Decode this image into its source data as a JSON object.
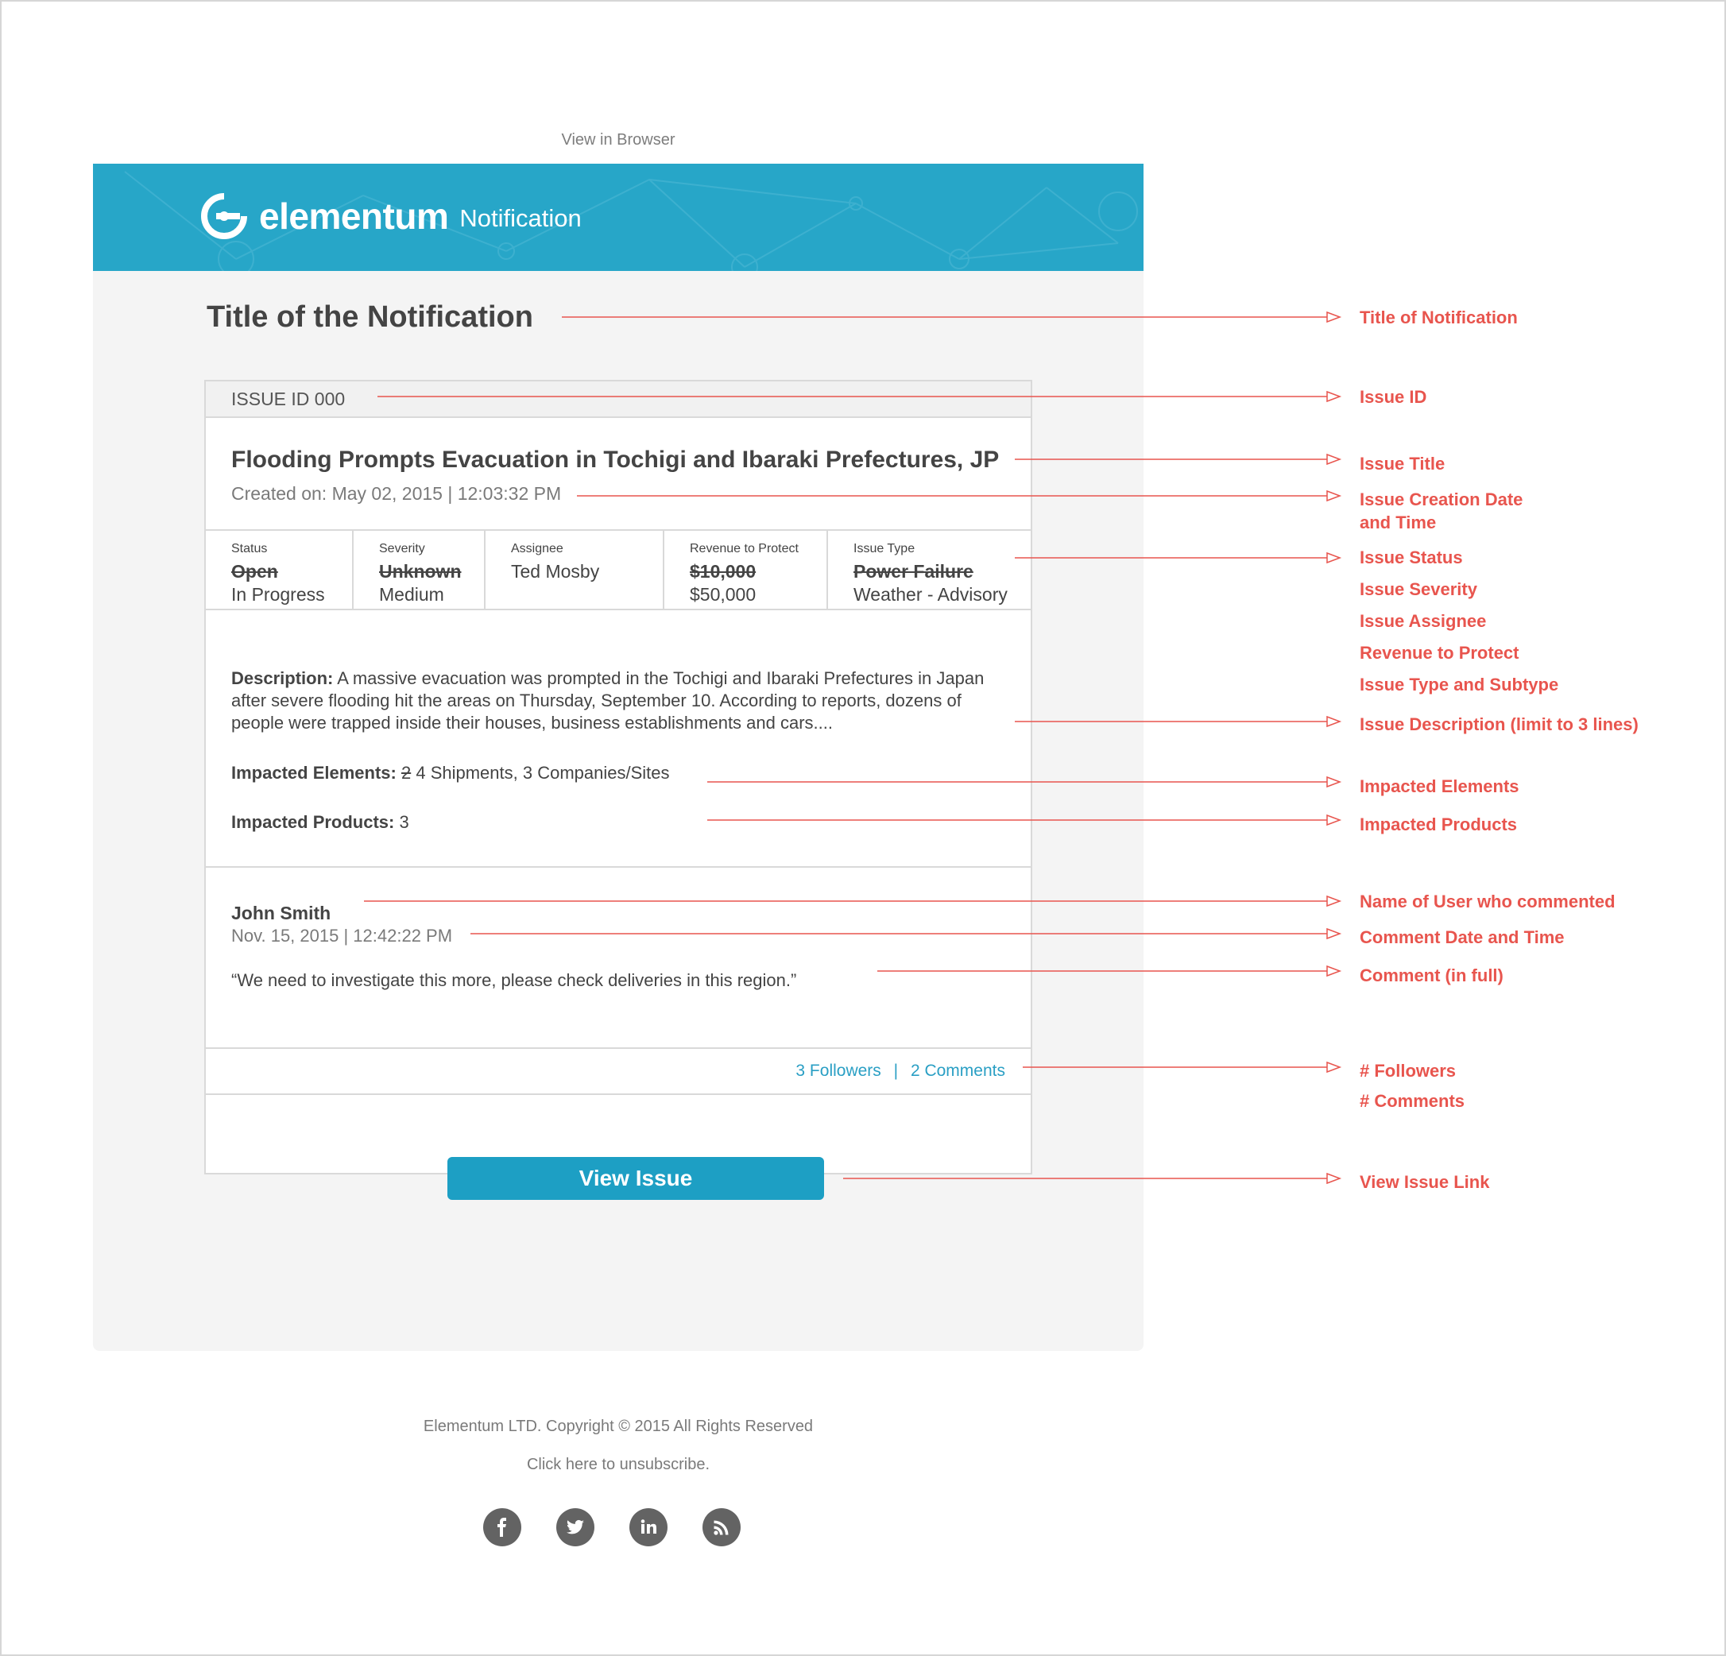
{
  "header": {
    "view_in_browser": "View in Browser",
    "brand_name": "elementum",
    "brand_suffix": "Notification"
  },
  "notification": {
    "title": "Title of the Notification"
  },
  "issue": {
    "id_label": "ISSUE ID 000",
    "title": "Flooding Prompts Evacuation in Tochigi and Ibaraki Prefectures, JP",
    "created": "Created on: May 02, 2015 | 12:03:32 PM",
    "meta": {
      "status": {
        "label": "Status",
        "old": "Open",
        "new": "In Progress"
      },
      "severity": {
        "label": "Severity",
        "old": "Unknown",
        "new": "Medium"
      },
      "assignee": {
        "label": "Assignee",
        "value": "Ted Mosby"
      },
      "revenue": {
        "label": "Revenue to Protect",
        "old": "$10,000",
        "new": "$50,000"
      },
      "type": {
        "label": "Issue Type",
        "old": "Power Failure",
        "new": "Weather - Advisory"
      }
    },
    "description_label": "Description:",
    "description": "A massive evacuation was prompted in the Tochigi and Ibaraki Prefectures in Japan after severe flooding hit the areas on Thursday, September 10. According to reports, dozens of people were trapped inside their houses, business establishments and cars....",
    "impacted_elements_label": "Impacted Elements:",
    "impacted_elements_old": "2",
    "impacted_elements": "4 Shipments, 3 Companies/Sites",
    "impacted_products_label": "Impacted Products:",
    "impacted_products": "3"
  },
  "comment": {
    "user": "John Smith",
    "date": "Nov. 15, 2015 | 12:42:22 PM",
    "text": "“We need to investigate this more, please check deliveries in this region.”"
  },
  "counts": {
    "followers": "3 Followers",
    "separator": "|",
    "comments": "2 Comments"
  },
  "cta": {
    "view_issue": "View Issue"
  },
  "footer": {
    "copyright": "Elementum LTD. Copyright © 2015 All Rights Reserved",
    "unsubscribe": "Click here to unsubscribe.",
    "socials": [
      "facebook-icon",
      "twitter-icon",
      "linkedin-icon",
      "rss-icon"
    ]
  },
  "annotations": {
    "title_of_notification": "Title of Notification",
    "issue_id": "Issue ID",
    "issue_title": "Issue Title",
    "issue_creation_line1": "Issue Creation Date",
    "issue_creation_line2": "and Time",
    "issue_status": "Issue Status",
    "issue_severity": "Issue Severity",
    "issue_assignee": "Issue Assignee",
    "revenue_to_protect": "Revenue to Protect",
    "issue_type": "Issue Type and Subtype",
    "issue_description": "Issue Description (limit to 3 lines)",
    "impacted_elements": "Impacted Elements",
    "impacted_products": "Impacted Products",
    "comment_user": "Name of User who commented",
    "comment_date": "Comment Date and Time",
    "comment_full": "Comment (in full)",
    "followers": "# Followers",
    "comments": "# Comments",
    "view_issue_link": "View Issue Link"
  },
  "colors": {
    "banner": "#27a6c8",
    "accent": "#1d9fc4",
    "annotation": "#e8554e",
    "social": "#636363"
  }
}
